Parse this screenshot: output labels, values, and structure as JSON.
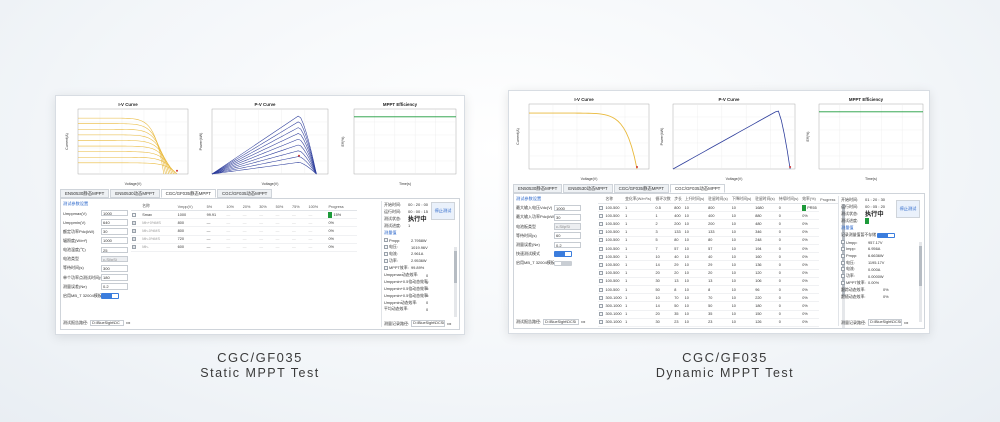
{
  "static": {
    "charts": {
      "iv_title": "I-V Curve",
      "pv_title": "P-V Curve",
      "eff_title": "MPPT Efficiency",
      "iv_xlabel": "Voltage(V)",
      "iv_ylabel": "Current(A)",
      "pv_xlabel": "Voltage(V)",
      "pv_ylabel": "Power(kW)",
      "eff_xlabel": "Time(s)",
      "eff_ylabel": "Eff(%)",
      "colors": {
        "iv": "#e9b93b",
        "pv": "#2e3e9c",
        "eff": "#1a9a3a"
      }
    },
    "tabs": [
      "EN50530静态MPPT",
      "EN50530动态MPPT",
      "CGC/GF035静态MPPT",
      "CGC/GF035动态MPPT"
    ],
    "active_tab": 2,
    "form": {
      "title": "测试参数设置",
      "rows": [
        {
          "label": "Umppmax(V)",
          "value": "1000"
        },
        {
          "label": "Umppmin(V)",
          "value": "640"
        },
        {
          "label": "额定功率Pdc(kW)",
          "value": "30"
        },
        {
          "label": "辐照度(W/m²)",
          "value": "1000"
        },
        {
          "label": "电池温度(℃)",
          "value": "25"
        },
        {
          "label": "电池类型",
          "value": "c-Si/pSi"
        },
        {
          "label": "等待时间(s)",
          "value": "300"
        },
        {
          "label": "单个功率点测试时间(s)",
          "value": "180"
        },
        {
          "label": "测量误差(Ne)",
          "value": "0.2"
        },
        {
          "label": "启用MB_T 32004模板",
          "value": ""
        }
      ],
      "path_label": "测试报告路径:",
      "path_value": "D:\\BlueSight\\DC",
      "dots": "•••"
    },
    "table": {
      "headers": [
        "",
        "名称",
        "Vmpp(V)",
        "5%",
        "10%",
        "20%",
        "30%",
        "50%",
        "75%",
        "100%",
        "Progress"
      ],
      "rows": [
        {
          "name": "Smax",
          "vmpp": "1000",
          "v1": "99.91",
          "progress": "15%"
        },
        {
          "name": "Mh+0%MS",
          "vmpp": "800",
          "v1": "—",
          "progress": "0%"
        },
        {
          "name": "Mh-0%MS",
          "vmpp": "800",
          "v1": "—",
          "progress": "0%"
        },
        {
          "name": "Mh-0%MS",
          "vmpp": "720",
          "v1": "—",
          "progress": "0%"
        },
        {
          "name": "Mh-",
          "vmpp": "600",
          "v1": "—",
          "progress": "0%"
        }
      ]
    },
    "side": {
      "start_label": "开始时间:",
      "start_value": "00 : 20 : 00",
      "run_label": "运行时间:",
      "run_value": "00 : 00 : 15",
      "status_label": "测试状态:",
      "status_value": "执行中",
      "count_label": "测试进度:",
      "count_value": "1",
      "stop_button": "停止测试",
      "section": "测量值",
      "measures": [
        {
          "label": "Pmpp:",
          "value": "2.7958W"
        },
        {
          "label": "电压:",
          "value": "1019.96V"
        },
        {
          "label": "电流:",
          "value": "2.961A"
        },
        {
          "label": "功率:",
          "value": "2.9536W"
        },
        {
          "label": "MPPT效率:",
          "value": "99.89%"
        }
      ],
      "extras": [
        {
          "label": "Umppmax动态效率:",
          "value": "0"
        },
        {
          "label": "Umppmin+0.5倍动态效率:",
          "value": "0"
        },
        {
          "label": "Umppmin+0.5倍动态效率:",
          "value": "0"
        },
        {
          "label": "Umppmin+0.5倍动态效率:",
          "value": "0"
        },
        {
          "label": "Umppmin动态效率:",
          "value": "0"
        },
        {
          "label": "平均动态效率:",
          "value": "0"
        }
      ],
      "path_label": "测量记录路径:",
      "path_value": "D:\\BlueSight\\DCSi",
      "dots": "•••"
    }
  },
  "dynamic": {
    "charts": {
      "iv_title": "I-V Curve",
      "pv_title": "P-V Curve",
      "eff_title": "MPPT Efficiency",
      "iv_xlabel": "Voltage(V)",
      "iv_ylabel": "Current(A)",
      "pv_xlabel": "Voltage(V)",
      "pv_ylabel": "Power(kW)",
      "eff_xlabel": "Time(s)",
      "eff_ylabel": "Eff(%)",
      "colors": {
        "iv": "#e9b93b",
        "pv": "#2e3e9c",
        "eff": "#1a9a3a"
      }
    },
    "tabs": [
      "EN50530静态MPPT",
      "EN50530动态MPPT",
      "CGC/GF035静态MPPT",
      "CGC/GF035动态MPPT"
    ],
    "active_tab": 3,
    "form": {
      "title": "测试参数设置",
      "rows": [
        {
          "label": "最大输入电压Vdc(V)",
          "value": "1000"
        },
        {
          "label": "最大输入功率Pdc(kW)",
          "value": "30"
        },
        {
          "label": "电池板类型",
          "value": "c-Si/pSi"
        },
        {
          "label": "等待时间(s)",
          "value": "60"
        },
        {
          "label": "测量误差(Ne)",
          "value": "0.2"
        },
        {
          "label": "快速测试模式",
          "value": ""
        },
        {
          "label": "启用MB_T 32004模板",
          "value": ""
        }
      ],
      "path_label": "测试报告路径:",
      "path_value": "D:\\BlueSight\\DCSi",
      "dots": "•••"
    },
    "table": {
      "headers": [
        "",
        "名称",
        "变化率(W/m²/s)",
        "循环次数",
        "步长",
        "上升时间(s)",
        "驻留时间(s)",
        "下降时间(s)",
        "驻留时间(s)",
        "持续时间(s)",
        "效率(%)",
        "Progress"
      ],
      "rows": [
        [
          "100-500",
          "1",
          "0.5",
          "800",
          "10",
          "800",
          "10",
          "1680",
          "0",
          "PR55"
        ],
        [
          "100-500",
          "1",
          "1",
          "400",
          "10",
          "400",
          "10",
          "880",
          "0",
          "0%"
        ],
        [
          "100-500",
          "1",
          "2",
          "200",
          "10",
          "200",
          "10",
          "480",
          "0",
          "0%"
        ],
        [
          "100-500",
          "1",
          "3",
          "133",
          "10",
          "133",
          "10",
          "346",
          "0",
          "0%"
        ],
        [
          "100-500",
          "1",
          "5",
          "80",
          "10",
          "80",
          "10",
          "248",
          "0",
          "0%"
        ],
        [
          "100-500",
          "1",
          "7",
          "57",
          "10",
          "57",
          "10",
          "194",
          "0",
          "0%"
        ],
        [
          "100-500",
          "1",
          "10",
          "40",
          "10",
          "40",
          "10",
          "160",
          "0",
          "0%"
        ],
        [
          "100-500",
          "1",
          "14",
          "29",
          "10",
          "29",
          "10",
          "136",
          "0",
          "0%"
        ],
        [
          "100-500",
          "1",
          "20",
          "20",
          "10",
          "20",
          "10",
          "120",
          "0",
          "0%"
        ],
        [
          "100-500",
          "1",
          "30",
          "13",
          "10",
          "13",
          "10",
          "106",
          "0",
          "0%"
        ],
        [
          "100-500",
          "1",
          "50",
          "8",
          "10",
          "8",
          "10",
          "96",
          "0",
          "0%"
        ],
        [
          "300-1000",
          "1",
          "10",
          "70",
          "10",
          "70",
          "10",
          "220",
          "0",
          "0%"
        ],
        [
          "300-1000",
          "1",
          "14",
          "50",
          "10",
          "50",
          "10",
          "180",
          "0",
          "0%"
        ],
        [
          "300-1000",
          "1",
          "20",
          "35",
          "10",
          "35",
          "10",
          "150",
          "0",
          "0%"
        ],
        [
          "300-1000",
          "1",
          "30",
          "23",
          "10",
          "23",
          "10",
          "126",
          "0",
          "0%"
        ]
      ]
    },
    "side": {
      "start_label": "开始时间:",
      "start_value": "01 : 20 : 30",
      "run_label": "运行时间:",
      "run_value": "00 : 05 : 20",
      "status_label": "测试状态:",
      "status_value": "执行中",
      "count_label": "测试进度:",
      "count_value": "",
      "stop_button": "停止测试",
      "section": "测量值",
      "record_label": "记录测量值暂不存储",
      "measures": [
        {
          "label": "Umpp:",
          "value": "957.17V"
        },
        {
          "label": "Impp:",
          "value": "6.956A"
        },
        {
          "label": "Pmpp:",
          "value": "6.6636W"
        },
        {
          "label": "电压:",
          "value": "1195.17V"
        },
        {
          "label": "电流:",
          "value": "0.000A"
        },
        {
          "label": "功率:",
          "value": "0.0000W"
        },
        {
          "label": "MPPT效率:",
          "value": "0.00%"
        }
      ],
      "extras": [
        {
          "label": "跟踪动态效率:",
          "value": "0%"
        },
        {
          "label": "跟随动态效率:",
          "value": "0%"
        }
      ],
      "path_label": "测量记录路径:",
      "path_value": "D:\\BlueSight\\DCSi",
      "dots": "•••"
    }
  },
  "captions": {
    "left_line1": "CGC/GF035",
    "left_line2": "Static MPPT Test",
    "right_line1": "CGC/GF035",
    "right_line2": "Dynamic MPPT Test"
  }
}
